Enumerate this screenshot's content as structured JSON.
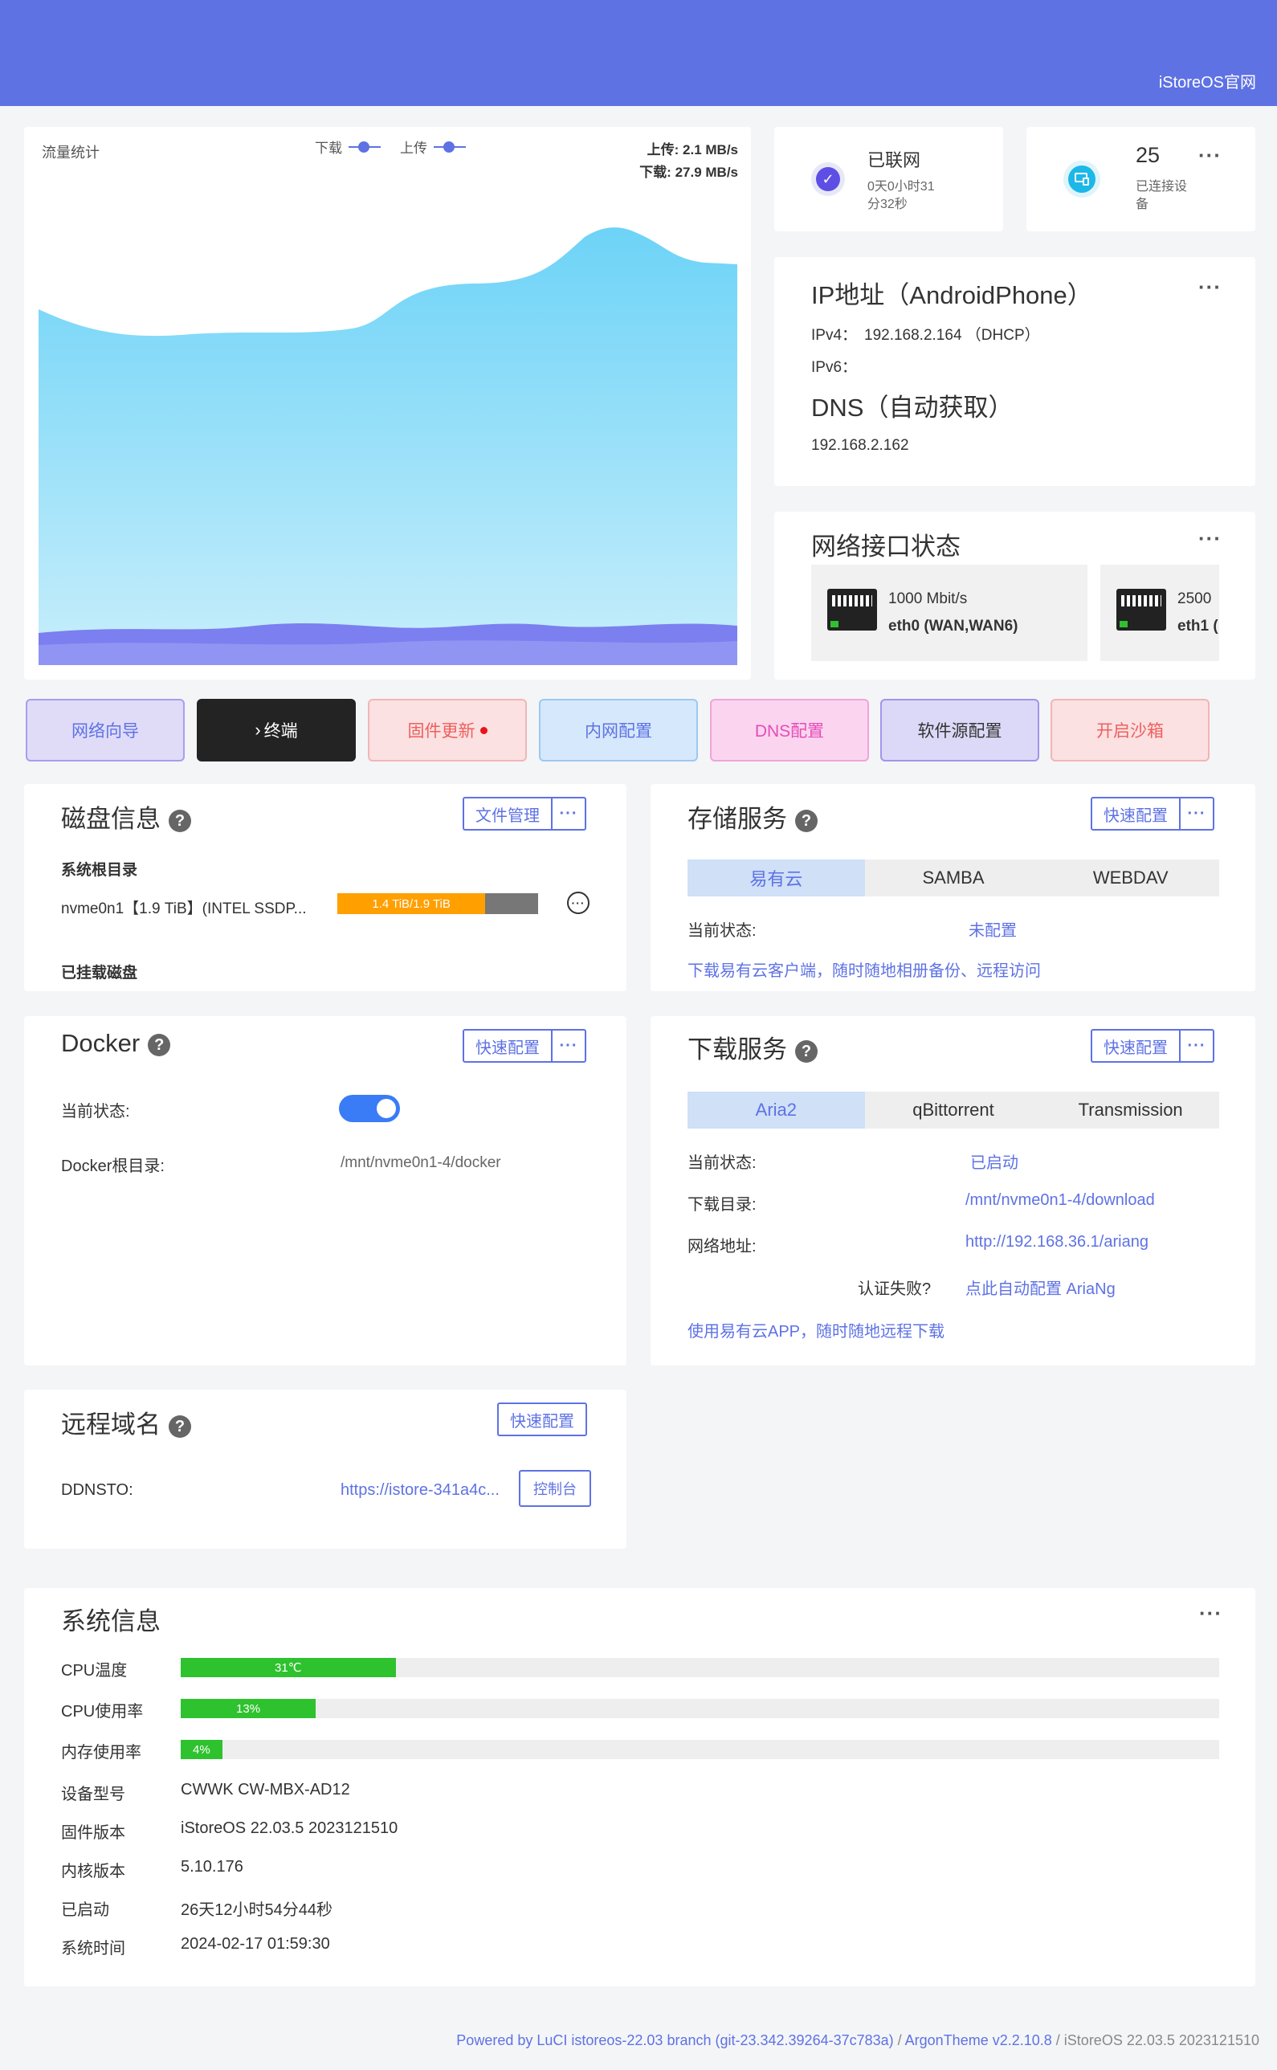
{
  "header": {
    "link": "iStoreOS官网",
    "bg": "#5e72e4"
  },
  "traffic": {
    "title": "流量统计",
    "legend_down": "下载",
    "legend_up": "上传",
    "upload": "上传: 2.1 MB/s",
    "download": "下载: 27.9 MB/s"
  },
  "connection": {
    "status": "已联网",
    "uptime_line1": "0天0小时31",
    "uptime_line2": "分32秒"
  },
  "devices": {
    "count": "25",
    "label_line1": "已连接设",
    "label_line2": "备"
  },
  "ip": {
    "title": "IP地址（AndroidPhone）",
    "ipv4_label": "IPv4：",
    "ipv4": "192.168.2.164 （DHCP）",
    "ipv6_label": "IPv6：",
    "dns_title": "DNS（自动获取）",
    "dns": "192.168.2.162"
  },
  "netif": {
    "title": "网络接口状态",
    "ports": [
      {
        "speed": "1000 Mbit/s",
        "name": "eth0 (WAN,WAN6)"
      },
      {
        "speed": "2500",
        "name": "eth1 ("
      }
    ]
  },
  "quick_buttons": [
    {
      "label": "网络向导"
    },
    {
      "label": "终端"
    },
    {
      "label": "固件更新"
    },
    {
      "label": "内网配置"
    },
    {
      "label": "DNS配置"
    },
    {
      "label": "软件源配置"
    },
    {
      "label": "开启沙箱"
    }
  ],
  "disk": {
    "title": "磁盘信息",
    "file_mgmt": "文件管理",
    "root_label": "系统根目录",
    "device": "nvme0n1【1.9 TiB】(INTEL SSDP...",
    "usage_text": "1.4 TiB/1.9 TiB",
    "usage_fraction": 0.737,
    "mounted_label": "已挂载磁盘"
  },
  "storage": {
    "title": "存储服务",
    "quick": "快速配置",
    "tabs": [
      "易有云",
      "SAMBA",
      "WEBDAV"
    ],
    "status_label": "当前状态:",
    "status_value": "未配置",
    "hint": "下载易有云客户端，随时随地相册备份、远程访问"
  },
  "docker": {
    "title": "Docker",
    "quick": "快速配置",
    "status_label": "当前状态:",
    "root_label": "Docker根目录:",
    "root_value": "/mnt/nvme0n1-4/docker"
  },
  "download": {
    "title": "下载服务",
    "quick": "快速配置",
    "tabs": [
      "Aria2",
      "qBittorrent",
      "Transmission"
    ],
    "status_label": "当前状态:",
    "status_value": "已启动",
    "dir_label": "下载目录:",
    "dir_value": "/mnt/nvme0n1-4/download",
    "url_label": "网络地址:",
    "url_value": "http://192.168.36.1/ariang",
    "auth_label": "认证失败?",
    "auth_link": "点此自动配置 AriaNg",
    "hint": "使用易有云APP，随时随地远程下载"
  },
  "ddns": {
    "title": "远程域名",
    "quick": "快速配置",
    "label": "DDNSTO:",
    "value": "https://istore-341a4c...",
    "console": "控制台"
  },
  "sysinfo": {
    "title": "系统信息",
    "cpu_temp_label": "CPU温度",
    "cpu_temp": "31℃",
    "cpu_temp_fraction": 0.207,
    "cpu_usage_label": "CPU使用率",
    "cpu_usage": "13%",
    "cpu_usage_fraction": 0.13,
    "mem_label": "内存使用率",
    "mem": "4%",
    "mem_fraction": 0.04,
    "rows": [
      {
        "label": "设备型号",
        "value": "CWWK CW-MBX-AD12"
      },
      {
        "label": "固件版本",
        "value": "iStoreOS 22.03.5 2023121510"
      },
      {
        "label": "内核版本",
        "value": "5.10.176"
      },
      {
        "label": "已启动",
        "value": "26天12小时54分44秒"
      },
      {
        "label": "系统时间",
        "value": "2024-02-17 01:59:30"
      }
    ]
  },
  "footer": {
    "powered": "Powered by LuCI istoreos-22.03 branch (git-23.342.39264-37c783a)",
    "sep1": " / ",
    "theme": "ArgonTheme v2.2.10.8",
    "sep2": " / ",
    "version": "iStoreOS 22.03.5 2023121510"
  }
}
